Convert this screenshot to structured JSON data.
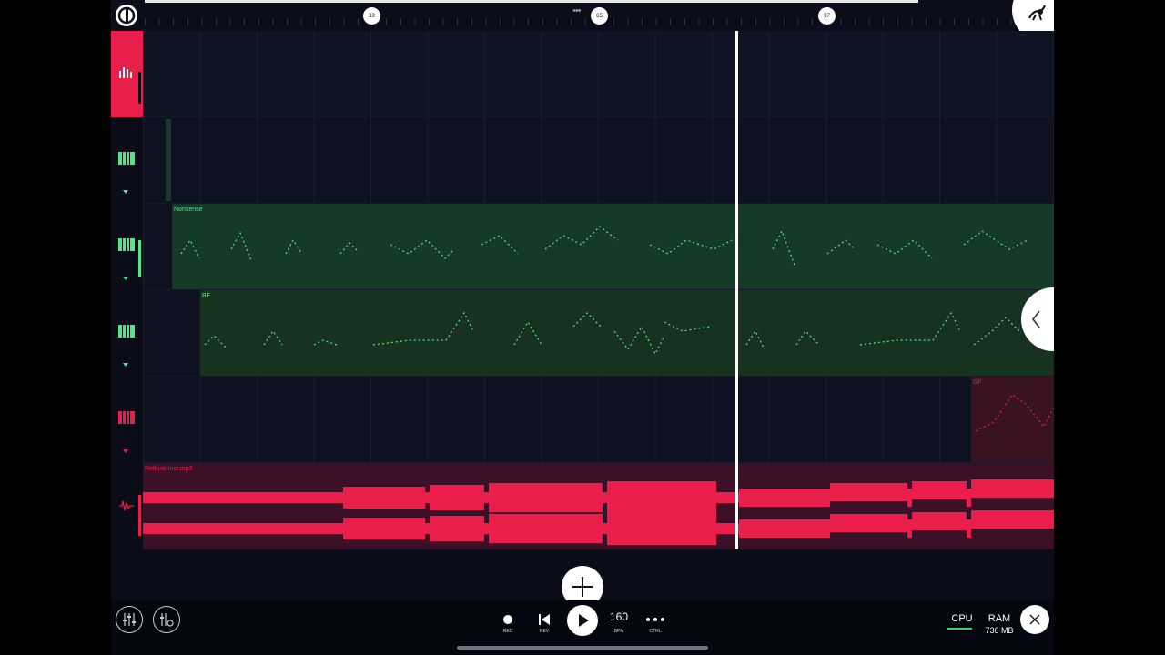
{
  "timeline": {
    "markers": [
      "33",
      "65",
      "97"
    ],
    "drag_handle": "•••"
  },
  "tracks": [
    {
      "type": "audio-fx",
      "icon": "equalizer-icon",
      "color": "#ea1e4a",
      "selected": true,
      "clip": null
    },
    {
      "type": "instrument",
      "icon": "piano-keys-icon",
      "color": "#52e68a",
      "clip": null
    },
    {
      "type": "instrument",
      "icon": "piano-keys-icon",
      "color": "#52e68a",
      "clip": {
        "label": "Nonsense",
        "color": "#52e68a"
      }
    },
    {
      "type": "instrument",
      "icon": "piano-keys-icon",
      "color": "#52e68a",
      "clip": {
        "label": "BF",
        "color": "#52e68a"
      }
    },
    {
      "type": "instrument",
      "icon": "piano-keys-icon",
      "color": "#ea1e4a",
      "clip": {
        "label": "GF",
        "color": "#ea1e4a"
      }
    },
    {
      "type": "audio",
      "icon": "waveform-icon",
      "color": "#ea1e4a",
      "clip": {
        "label": "Rethink Inst.mp3",
        "color": "#ea1e4a"
      }
    }
  ],
  "transport": {
    "rec_label": "REC",
    "rev_label": "REV",
    "bpm_value": "160",
    "bpm_label": "BPM",
    "ctrl_label": "CTRL",
    "ctrl_icon": "more-dots-icon"
  },
  "status": {
    "cpu_label": "CPU",
    "ram_label": "RAM",
    "ram_value": "736 MB"
  },
  "colors": {
    "accent_red": "#ea1e4a",
    "accent_green": "#52e68a",
    "background": "#0d1120"
  }
}
